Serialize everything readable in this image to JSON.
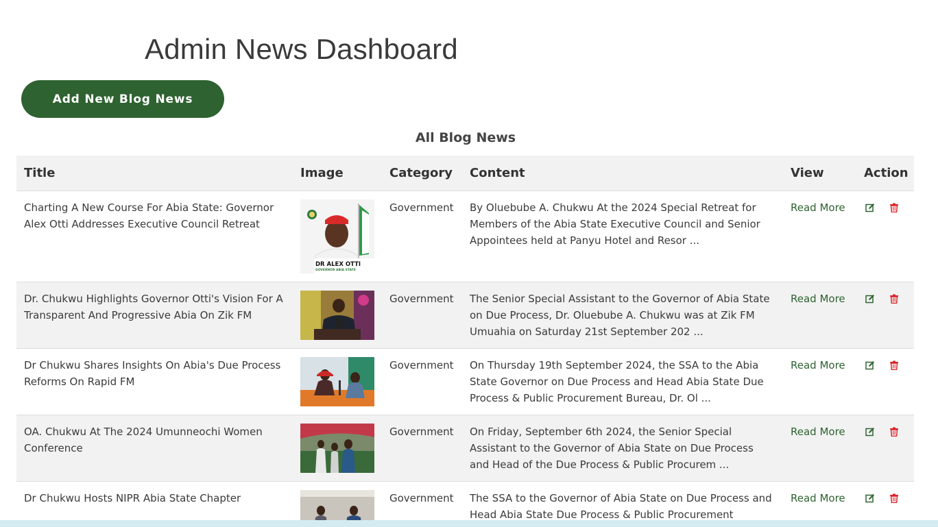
{
  "header": {
    "title": "Admin News Dashboard",
    "add_button_label": "Add New Blog News"
  },
  "section": {
    "title": "All Blog News"
  },
  "table": {
    "columns": [
      "Title",
      "Image",
      "Category",
      "Content",
      "View",
      "Action"
    ],
    "rows": [
      {
        "title": "Charting A New Course For Abia State: Governor Alex Otti Addresses Executive Council Retreat",
        "image_caption": "DR ALEX OTTI",
        "image_subcaption": "GOVERNOR ABIA STATE",
        "category": "Government",
        "content": "By Oluebube A. Chukwu At the 2024 Special Retreat for Members of the Abia State Executive Council and Senior Appointees held at Panyu Hotel and Resor ...",
        "view_label": "Read More"
      },
      {
        "title": "Dr. Chukwu Highlights Governor Otti's Vision For A Transparent And Progressive Abia On Zik FM",
        "category": "Government",
        "content": "The Senior Special Assistant to the Governor of Abia State on Due Process, Dr. Oluebube A. Chukwu was at Zik FM Umuahia on Saturday 21st September 202 ...",
        "view_label": "Read More"
      },
      {
        "title": "Dr Chukwu Shares Insights On Abia's Due Process Reforms On Rapid FM",
        "category": "Government",
        "content": "On Thursday 19th September 2024, the SSA to the Abia State Governor on Due Process and Head Abia State Due Process & Public Procurement Bureau, Dr. Ol ...",
        "view_label": "Read More"
      },
      {
        "title": "OA. Chukwu At The 2024 Umunneochi Women Conference",
        "category": "Government",
        "content": "On Friday, September 6th 2024, the Senior Special Assistant to the Governor of Abia State on Due Process and Head of the Due Process & Public Procurem ...",
        "view_label": "Read More"
      },
      {
        "title": "Dr Chukwu Hosts NIPR Abia State Chapter",
        "category": "Government",
        "content": "The SSA to the Governor of Abia State on Due Process and Head Abia State Due Process & Public Procurement",
        "view_label": "Read More"
      }
    ]
  },
  "colors": {
    "primary_green": "#2e6230",
    "delete_red": "#d9252a",
    "header_bg": "#f2f2f2"
  },
  "icons": {
    "edit": "edit-icon",
    "delete": "trash-icon"
  }
}
